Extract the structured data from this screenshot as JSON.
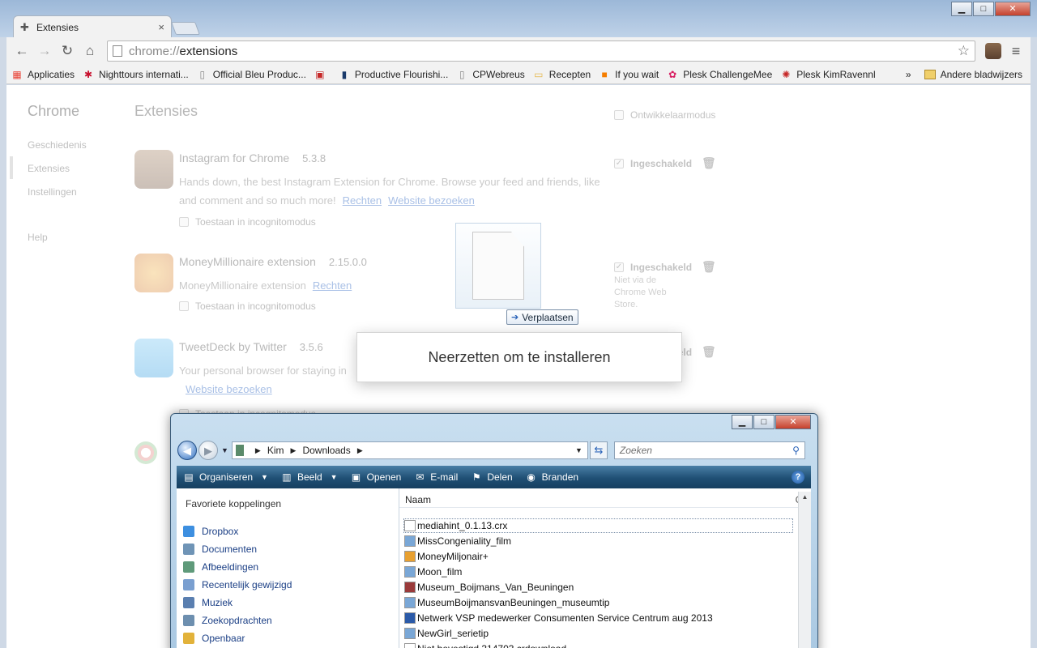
{
  "chrome": {
    "tab_title": "Extensies",
    "url_scheme": "chrome://",
    "url_path": "extensions",
    "bookmarks": [
      {
        "label": "Applicaties",
        "icon": "apps-grid-icon",
        "color": "#e94235"
      },
      {
        "label": "Nighttours internati...",
        "icon": "star-icon",
        "color": "#c8102e"
      },
      {
        "label": "Official Bleu Produc...",
        "icon": "page-icon",
        "color": "#888888"
      },
      {
        "label": "",
        "icon": "bookmark-red-icon",
        "color": "#c62828"
      },
      {
        "label": "Productive Flourishi...",
        "icon": "pf-logo-icon",
        "color": "#1a3a6b"
      },
      {
        "label": "CPWebreus",
        "icon": "page-icon",
        "color": "#888888"
      },
      {
        "label": "Recepten",
        "icon": "folder-icon",
        "color": "#e6b84a"
      },
      {
        "label": "If you wait",
        "icon": "blogger-icon",
        "color": "#f57d00"
      },
      {
        "label": "Plesk ChallengeMee",
        "icon": "plesk-icon",
        "color": "#d81b60"
      },
      {
        "label": "Plesk KimRavennl",
        "icon": "plesk-gear-icon",
        "color": "#c62828"
      }
    ],
    "bookmarks_more": "»",
    "other_bookmarks": "Andere bladwijzers"
  },
  "extensions_page": {
    "brand": "Chrome",
    "nav": [
      "Geschiedenis",
      "Extensies",
      "Instellingen",
      "Help"
    ],
    "title": "Extensies",
    "dev_mode_label": "Ontwikkelaarmodus",
    "items": [
      {
        "name": "Instagram for Chrome",
        "version": "5.3.8",
        "desc": "Hands down, the best Instagram Extension for Chrome. Browse your feed and friends, like and comment and so much more!",
        "link1": "Rechten",
        "link2": "Website bezoeken",
        "incognito": "Toestaan in incognitomodus",
        "enabled": "Ingeschakeld",
        "note": ""
      },
      {
        "name": "MoneyMillionaire extension",
        "version": "2.15.0.0",
        "desc": "MoneyMillionaire extension",
        "link1": "Rechten",
        "link2": "",
        "incognito": "Toestaan in incognitomodus",
        "enabled": "Ingeschakeld",
        "note": "Niet via de Chrome Web Store."
      },
      {
        "name": "TweetDeck by Twitter",
        "version": "3.5.6",
        "desc": "Your personal browser for staying in",
        "link1": "",
        "link2": "Website bezoeken",
        "incognito": "Toestaan in incognitomodus",
        "enabled": "Ingeschakeld",
        "note": ""
      }
    ]
  },
  "drag": {
    "tooltip": "Verplaatsen",
    "drop_message": "Neerzetten om te installeren"
  },
  "explorer": {
    "path": [
      "Kim",
      "Downloads"
    ],
    "search_placeholder": "Zoeken",
    "commands": [
      {
        "label": "Organiseren",
        "icon": "organize-icon",
        "dropdown": true
      },
      {
        "label": "Beeld",
        "icon": "views-icon",
        "dropdown": true
      },
      {
        "label": "Openen",
        "icon": "open-icon",
        "dropdown": false
      },
      {
        "label": "E-mail",
        "icon": "email-icon",
        "dropdown": false
      },
      {
        "label": "Delen",
        "icon": "share-icon",
        "dropdown": false
      },
      {
        "label": "Branden",
        "icon": "burn-disc-icon",
        "dropdown": false
      }
    ],
    "favorites_header": "Favoriete koppelingen",
    "favorites": [
      {
        "label": "Dropbox",
        "color": "#3d8fe0"
      },
      {
        "label": "Documenten",
        "color": "#6f94b6"
      },
      {
        "label": "Afbeeldingen",
        "color": "#5f9a7a"
      },
      {
        "label": "Recentelijk gewijzigd",
        "color": "#7a9fd0"
      },
      {
        "label": "Muziek",
        "color": "#5a7fb0"
      },
      {
        "label": "Zoekopdrachten",
        "color": "#6d8faf"
      },
      {
        "label": "Openbaar",
        "color": "#e2b23a"
      }
    ],
    "column_name": "Naam",
    "column_more": "G",
    "files": [
      {
        "label": "mediahint_0.1.13.crx",
        "color": "#ffffff"
      },
      {
        "label": "MissCongeniality_film",
        "color": "#7aa7d6"
      },
      {
        "label": "MoneyMiljonair+",
        "color": "#e8a030"
      },
      {
        "label": "Moon_film",
        "color": "#7aa7d6"
      },
      {
        "label": "Museum_Boijmans_Van_Beuningen",
        "color": "#9a3a3a"
      },
      {
        "label": "MuseumBoijmansvanBeuningen_museumtip",
        "color": "#7aa7d6"
      },
      {
        "label": "Netwerk VSP medewerker Consumenten Service Centrum aug 2013",
        "color": "#2b5aa8"
      },
      {
        "label": "NewGirl_serietip",
        "color": "#7aa7d6"
      },
      {
        "label": "Niet bevestigd 314703.crdownload",
        "color": "#ffffff"
      }
    ]
  },
  "colors": {
    "chrome_frame": "#bfd2e8",
    "link_faded": "#a9c0e6",
    "explorer_cmdbar": "#1f4f74"
  }
}
